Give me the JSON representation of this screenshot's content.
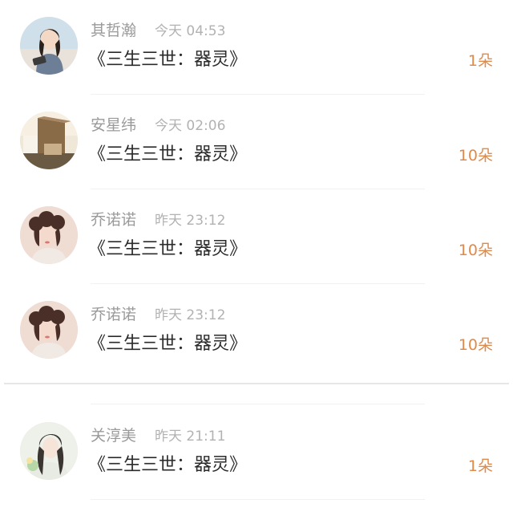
{
  "colors": {
    "name": "#9a9a9a",
    "time": "#b2b2b2",
    "title": "#2b2b2b",
    "gift": "#e08a4a",
    "divider": "#e6e6e6"
  },
  "items": [
    {
      "name": "其哲瀚",
      "time": "今天 04:53",
      "title": "《三生三世：器灵》",
      "gift": "1朵",
      "avatar": "girl-with-phone-avatar"
    },
    {
      "name": "安星纬",
      "time": "今天 02:06",
      "title": "《三生三世：器灵》",
      "gift": "10朵",
      "avatar": "interior-scene-avatar"
    },
    {
      "name": "乔诺诺",
      "time": "昨天 23:12",
      "title": "《三生三世：器灵》",
      "gift": "10朵",
      "avatar": "retro-portrait-avatar"
    },
    {
      "name": "乔诺诺",
      "time": "昨天 23:12",
      "title": "《三生三世：器灵》",
      "gift": "10朵",
      "avatar": "retro-portrait-avatar"
    },
    {
      "name": "关淳美",
      "time": "昨天 21:11",
      "title": "《三生三世：器灵》",
      "gift": "1朵",
      "avatar": "anime-character-avatar"
    }
  ]
}
